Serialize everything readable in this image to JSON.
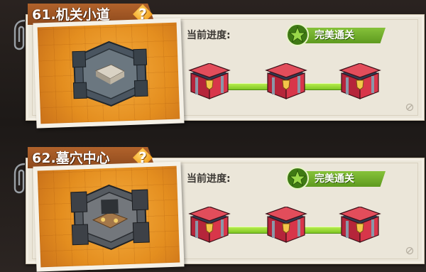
{
  "stages": [
    {
      "title": "61.机关小道",
      "help_glyph": "?",
      "progress_label": "当前进度:",
      "status": "完美通关",
      "chests": [
        "chest-1",
        "chest-2",
        "chest-3"
      ]
    },
    {
      "title": "62.墓穴中心",
      "help_glyph": "?",
      "progress_label": "当前进度:",
      "status": "完美通关",
      "chests": [
        "chest-1",
        "chest-2",
        "chest-3"
      ]
    }
  ],
  "colors": {
    "title_tab": "#a15726",
    "badge_green": "#6fab29",
    "progress_green": "#9bdc38",
    "chest_red": "#c4283d",
    "card_bg": "#ebe6d9"
  },
  "icons": [
    "help-icon",
    "star-icon",
    "treasure-chest-icon",
    "paperclip-icon",
    "no-entry-icon"
  ]
}
